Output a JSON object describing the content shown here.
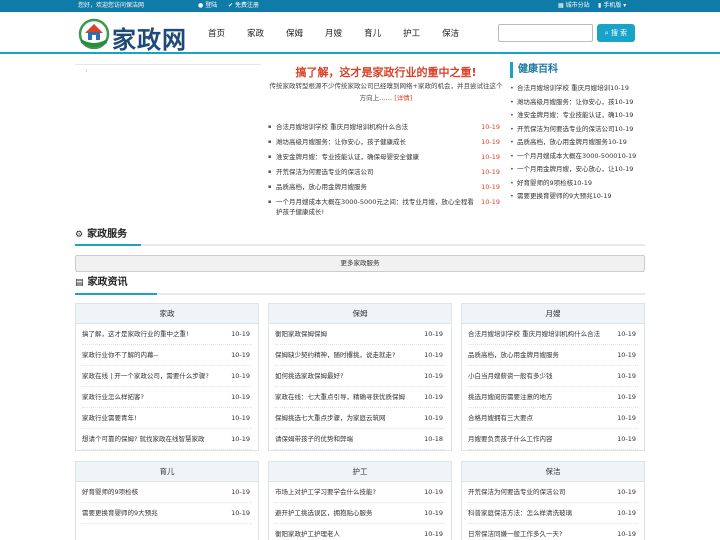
{
  "topbar": {
    "welcome": "您好，欢迎您访问保洁网",
    "login": "登陆",
    "register": "免费注册",
    "city": "城市分站",
    "mobile": "手机版"
  },
  "header": {
    "logo_text": "家政网",
    "nav": [
      "首页",
      "家政",
      "保姆",
      "月嫂",
      "育儿",
      "护工",
      "保洁"
    ],
    "search_placeholder": "",
    "search_button": "搜 索"
  },
  "headline": {
    "title": "搞了解，这才是家政行业的重中之重!",
    "summary": "传统家政转型根源不少传统家政公司已经嗅到网络+家政的机会，并且尝试往这个方向上……",
    "detail_link": "[详情]",
    "items": [
      {
        "title": "合法月嫂培训学校 重庆月嫂培训机构什么合法",
        "date": "10-19"
      },
      {
        "title": "潍坊高级月嫂服务：让你安心，孩子健康成长",
        "date": "10-19"
      },
      {
        "title": "淮安金牌月嫂：专业技能认证，确保母婴安全健康",
        "date": "10-19"
      },
      {
        "title": "开荒保洁为何要选专业的保洁公司",
        "date": "10-19"
      },
      {
        "title": "品质高档，放心用金牌月嫂服务",
        "date": "10-19"
      },
      {
        "title": "一个月月嫂成本大概在3000-5000元之间：找专业月嫂，放心全程看护孩子健康成长!",
        "date": "10-19"
      }
    ]
  },
  "health": {
    "title": "健康百科",
    "items": [
      "合法月嫂培训学校 重庆月嫂培训10-19",
      "潍坊高级月嫂服务：让你安心，孩10-19",
      "淮安金牌月嫂：专业技能认证，确10-19",
      "开荒保洁为何要选专业的保洁公司10-19",
      "品质高档，放心用金牌月嫂服务10-19",
      "一个月月嫂成本大概在3000-500010-19",
      "一个月用金牌月嫂，安心放心，让10-19",
      "好育婴师的9项检核10-19",
      "需要更换育婴师的9大预兆10-19"
    ]
  },
  "services": {
    "title": "家政服务",
    "more": "更多家政服务"
  },
  "news": {
    "title": "家政资讯",
    "boxes": [
      {
        "name": "家政",
        "items": [
          {
            "title": "搞了解，这才是家政行业的重中之重!",
            "date": "10-19"
          },
          {
            "title": "家政行业你不了解的内幕--",
            "date": "10-19"
          },
          {
            "title": "家政在线 | 开一个家政公司，需要什么步骤?",
            "date": "10-19"
          },
          {
            "title": "家政行业怎么样拓客?",
            "date": "10-19"
          },
          {
            "title": "家政行业需要青年!",
            "date": "10-19"
          },
          {
            "title": "想请个可靠的保姆? 就找家政在线智慧家政",
            "date": "10-19"
          }
        ]
      },
      {
        "name": "保姆",
        "items": [
          {
            "title": "衡阳家政保姆保姆",
            "date": "10-19"
          },
          {
            "title": "保姆缺少契约精神，随时撂挑，说走就走?",
            "date": "10-19"
          },
          {
            "title": "如何挑选家政保姆最好?",
            "date": "10-19"
          },
          {
            "title": "家政在线：七大重点引导，精确寻获优质保姆",
            "date": "10-19"
          },
          {
            "title": "保姆挑选七大重点步骤，为家庭云筑网",
            "date": "10-19"
          },
          {
            "title": "请保姆带孩子的优势和弊端",
            "date": "10-18"
          }
        ]
      },
      {
        "name": "月嫂",
        "items": [
          {
            "title": "合法月嫂培训学校 重庆月嫂培训机构什么合法",
            "date": "10-19"
          },
          {
            "title": "品质高档，放心用金牌月嫂服务",
            "date": "10-19"
          },
          {
            "title": "小白当月嫂薪资一般有多少钱",
            "date": "10-19"
          },
          {
            "title": "挑选月嫂阅历需要注意的地方",
            "date": "10-19"
          },
          {
            "title": "合格月嫂拥有三大要点",
            "date": "10-19"
          },
          {
            "title": "月嫂要负责孩子什么工作内容",
            "date": "10-19"
          }
        ]
      },
      {
        "name": "育儿",
        "items": [
          {
            "title": "好育婴师的9项检核",
            "date": "10-19"
          },
          {
            "title": "需要更换育婴师的9大预兆",
            "date": "10-19"
          }
        ]
      },
      {
        "name": "护工",
        "items": [
          {
            "title": "市场上对护工学习要学会什么技能?",
            "date": "10-19"
          },
          {
            "title": "避开护工挑选误区，拥抱贴心服务",
            "date": "10-19"
          },
          {
            "title": "衡阳家政护工护理老人",
            "date": "10-19"
          }
        ]
      },
      {
        "name": "保洁",
        "items": [
          {
            "title": "开荒保洁为何要选专业的保洁公司",
            "date": "10-19"
          },
          {
            "title": "科普家庭保洁方法：怎么样清洗玻璃",
            "date": "10-19"
          },
          {
            "title": "日常保洁同嫌一般工作多久一天?",
            "date": "10-19"
          }
        ]
      }
    ]
  },
  "colors": {
    "topbar": "#0f7ba8",
    "accent": "#1aa3c8",
    "headline": "#d9432a",
    "logo": "#1d4a78"
  }
}
